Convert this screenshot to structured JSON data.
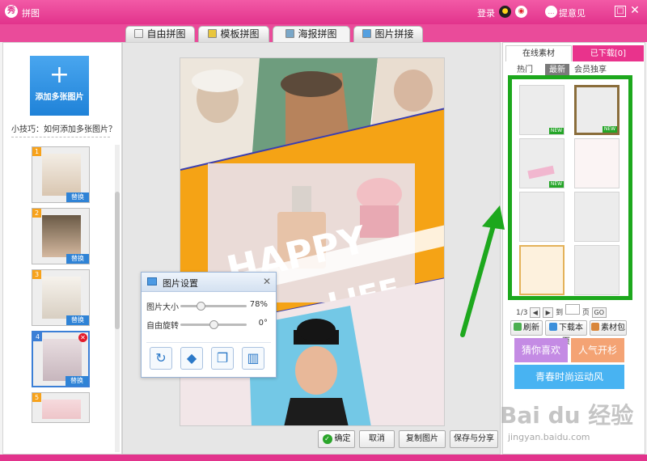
{
  "titlebar": {
    "app_title": "拼图",
    "logo_glyph": "秀",
    "login": "登录",
    "feedback": "提意见"
  },
  "tabs": [
    {
      "label": "自由拼图",
      "active": false
    },
    {
      "label": "模板拼图",
      "active": false
    },
    {
      "label": "海报拼图",
      "active": true
    },
    {
      "label": "图片拼接",
      "active": false
    }
  ],
  "left": {
    "add_button_label": "添加多张图片",
    "tip": "小技巧：如何添加多张图片？",
    "thumbnails": [
      {
        "num": "1",
        "replace": "替换"
      },
      {
        "num": "2",
        "replace": "替换"
      },
      {
        "num": "3",
        "replace": "替换"
      },
      {
        "num": "4",
        "replace": "替换",
        "selected": true
      },
      {
        "num": "5"
      }
    ]
  },
  "poster": {
    "text_happy": "HAPPY",
    "text_life": "LIFE",
    "accent": "#f5a315"
  },
  "dialog": {
    "title": "图片设置",
    "size_label": "图片大小",
    "size_value": "78%",
    "size_level": 0.28,
    "rotate_label": "自由旋转",
    "rotate_value": "0°",
    "rotate_level": 0.5
  },
  "bottom_buttons": {
    "confirm": "确定",
    "cancel": "取消",
    "copy": "复制图片",
    "save": "保存与分享"
  },
  "right": {
    "tab_online": "在线素材",
    "tab_downloaded": "已下载[0]",
    "subtabs": [
      "热门",
      "最新",
      "会员独享"
    ],
    "new_badge": "NEW",
    "page_current": "1/3",
    "goto_label": "到",
    "page_unit": "页",
    "go": "GO",
    "refresh": "刷新",
    "download_page": "下载本页",
    "material_pack": "素材包",
    "tag_guess": "猜你喜欢",
    "tag_popular": "人气开杉",
    "tag_youth": "青春时尚运动风"
  },
  "watermark": {
    "brand": "Bai du 经验",
    "url": "jingyan.baidu.com"
  }
}
